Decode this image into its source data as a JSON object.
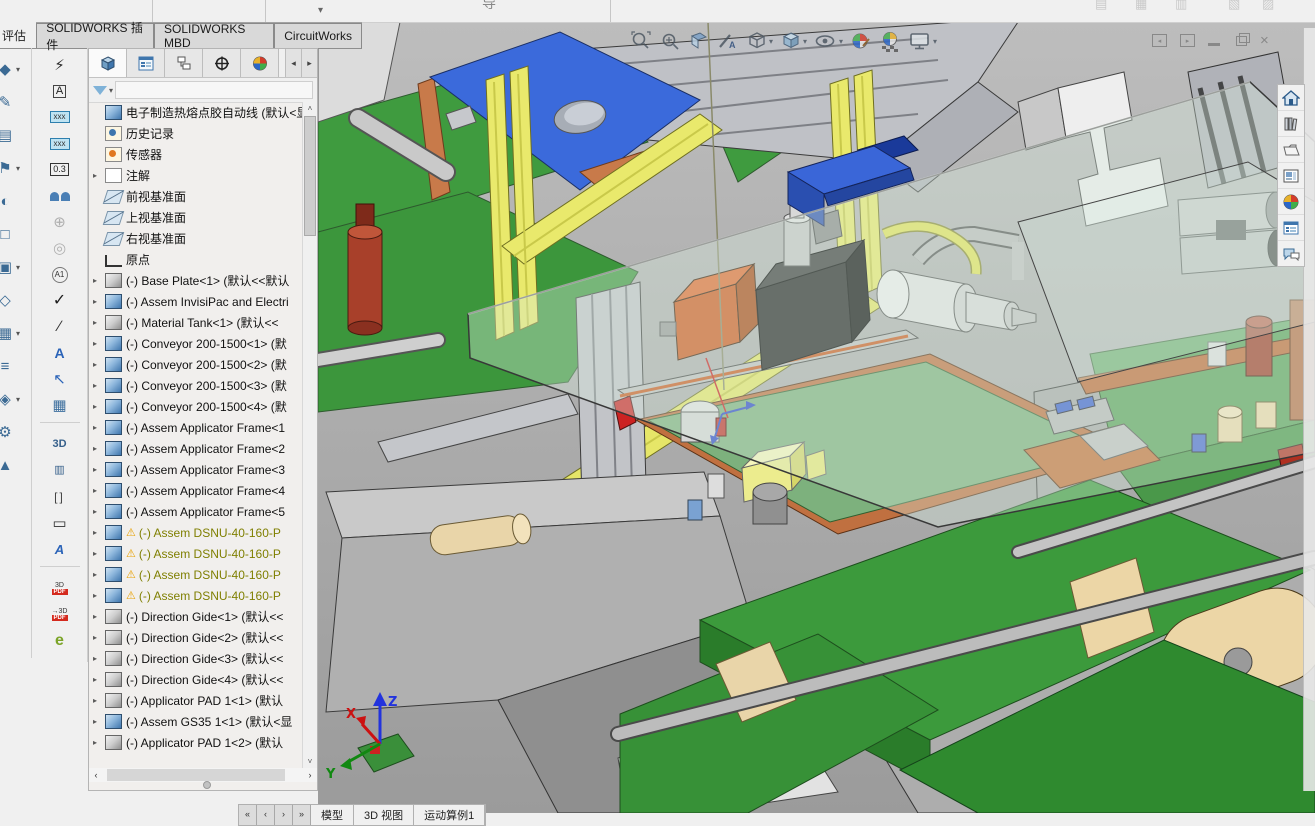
{
  "ribbon": {
    "partial_tab": "评估",
    "tabs": [
      "SOLIDWORKS 插件",
      "SOLIDWORKS MBD",
      "CircuitWorks"
    ],
    "top_strip": {
      "dropdown_glyph": "▾",
      "fragment": "导",
      "ghost_glyphs": [
        "▤",
        "▦",
        "▥",
        "▧",
        "▨"
      ]
    }
  },
  "left_toolbar_primary": [
    {
      "g": "◆",
      "arr": true
    },
    {
      "g": "✎",
      "arr": false
    },
    {
      "g": "▤",
      "arr": false
    },
    {
      "g": "⚑",
      "arr": true
    },
    {
      "g": "◐",
      "arr": false
    },
    {
      "g": "□",
      "arr": false
    },
    {
      "g": "▣",
      "arr": true
    },
    {
      "g": "◇",
      "arr": false
    },
    {
      "g": "▦",
      "arr": true
    },
    {
      "g": "≡",
      "arr": false
    },
    {
      "g": "◈",
      "arr": true
    },
    {
      "g": "⚙",
      "arr": false
    },
    {
      "g": "▲",
      "arr": false
    }
  ],
  "left_toolbar_secondary": [
    {
      "name": "invisipac-power",
      "g": "⚡",
      "g2": "",
      "cls": ""
    },
    {
      "name": "smart-dimension",
      "g": "A",
      "g2": "",
      "cls": "dim"
    },
    {
      "name": "auto-balloon",
      "g": "xxx",
      "g2": "",
      "cls": "bal"
    },
    {
      "name": "balloon",
      "g": "xxx",
      "g2": "",
      "cls": "bal2"
    },
    {
      "name": "geometric-tolerance",
      "g": "0.3",
      "g2": "",
      "cls": "tol"
    },
    {
      "name": "mates",
      "g": "",
      "g2": "",
      "cls": "people"
    },
    {
      "name": "dimxpert-location",
      "g": "⊕",
      "g2": "",
      "cls": "dis"
    },
    {
      "name": "hide-show",
      "g": "◎",
      "g2": "",
      "cls": "dis"
    },
    {
      "name": "magnified-view",
      "g": "A1",
      "g2": "",
      "cls": "maga1"
    },
    {
      "name": "spell-check",
      "g": "✓",
      "g2": "",
      "cls": "chk"
    },
    {
      "name": "measure",
      "g": "∕",
      "g2": "",
      "cls": "meas"
    },
    {
      "name": "note",
      "g": "A",
      "g2": "",
      "cls": "note"
    },
    {
      "name": "leader",
      "g": "↖",
      "g2": "",
      "cls": "arr"
    },
    {
      "name": "general-table",
      "g": "▦",
      "g2": "",
      "cls": "tbl sepafter"
    },
    {
      "name": "3d-view-capture",
      "g": "3D",
      "g2": "",
      "cls": "cam"
    },
    {
      "name": "model-break-view",
      "g": "▥",
      "g2": "",
      "cls": "fold"
    },
    {
      "name": "break-view",
      "g": "[]",
      "g2": "",
      "cls": "brk"
    },
    {
      "name": "annotation-view",
      "g": "▭",
      "g2": "",
      "cls": "pn"
    },
    {
      "name": "weld-symbol",
      "g": "A",
      "g2": "",
      "cls": "scw sepafter"
    },
    {
      "name": "edit-3d-pdf",
      "g": "3D",
      "g2": "PDF",
      "cls": "pdf"
    },
    {
      "name": "publish-3d-pdf",
      "g": "→3D",
      "g2": "PDF",
      "cls": "pdf2"
    },
    {
      "name": "publish-edrawings",
      "g": "e",
      "g2": "",
      "cls": "ed"
    }
  ],
  "feature_manager": {
    "tabs": [
      "features-tree",
      "property-manager",
      "configuration-manager",
      "dimxpert-manager",
      "display-manager"
    ],
    "tab_scroll_left": "◂",
    "tab_scroll_right": "▸",
    "expander_glyph": "▸",
    "warn_glyph": "⚠",
    "scroll_up_glyph": "˄",
    "scroll_down_glyph": "˅",
    "hscroll_left": "‹",
    "hscroll_right": "›",
    "root_label": "电子制造热熔点胶自动线 (默认<显示",
    "tree": [
      {
        "icon": "history",
        "label": "历史记录"
      },
      {
        "icon": "sensor",
        "label": "传感器"
      },
      {
        "icon": "ann",
        "label": "注解",
        "expand": true
      },
      {
        "icon": "plane",
        "label": "前视基准面"
      },
      {
        "icon": "plane",
        "label": "上视基准面"
      },
      {
        "icon": "plane",
        "label": "右视基准面"
      },
      {
        "icon": "origin",
        "label": "原点"
      },
      {
        "icon": "part",
        "expand": true,
        "label": "(-) Base Plate<1> (默认<<默认"
      },
      {
        "icon": "asm",
        "expand": true,
        "label": "(-) Assem InvisiPac and Electri"
      },
      {
        "icon": "part",
        "expand": true,
        "label": "(-) Material Tank<1> (默认<<"
      },
      {
        "icon": "asm",
        "expand": true,
        "label": "(-) Conveyor 200-1500<1> (默"
      },
      {
        "icon": "asm",
        "expand": true,
        "label": "(-) Conveyor 200-1500<2> (默"
      },
      {
        "icon": "asm",
        "expand": true,
        "label": "(-) Conveyor 200-1500<3> (默"
      },
      {
        "icon": "asm",
        "expand": true,
        "label": "(-) Conveyor 200-1500<4> (默"
      },
      {
        "icon": "asm",
        "expand": true,
        "label": "(-) Assem Applicator Frame<1"
      },
      {
        "icon": "asm",
        "expand": true,
        "label": "(-) Assem Applicator Frame<2"
      },
      {
        "icon": "asm",
        "expand": true,
        "label": "(-) Assem Applicator Frame<3"
      },
      {
        "icon": "asm",
        "expand": true,
        "label": "(-) Assem Applicator Frame<4"
      },
      {
        "icon": "asm",
        "expand": true,
        "label": "(-) Assem Applicator Frame<5"
      },
      {
        "icon": "asm",
        "expand": true,
        "warn": true,
        "label": "(-) Assem DSNU-40-160-P"
      },
      {
        "icon": "asm",
        "expand": true,
        "warn": true,
        "label": "(-) Assem DSNU-40-160-P"
      },
      {
        "icon": "asm",
        "expand": true,
        "warn": true,
        "label": "(-) Assem DSNU-40-160-P"
      },
      {
        "icon": "asm",
        "expand": true,
        "warn": true,
        "label": "(-) Assem DSNU-40-160-P"
      },
      {
        "icon": "part",
        "expand": true,
        "label": "(-) Direction Gide<1> (默认<<"
      },
      {
        "icon": "part",
        "expand": true,
        "label": "(-) Direction Gide<2> (默认<<"
      },
      {
        "icon": "part",
        "expand": true,
        "label": "(-) Direction Gide<3> (默认<<"
      },
      {
        "icon": "part",
        "expand": true,
        "label": "(-) Direction Gide<4> (默认<<"
      },
      {
        "icon": "part",
        "expand": true,
        "label": "(-) Applicator PAD 1<1> (默认"
      },
      {
        "icon": "asm",
        "expand": true,
        "label": "(-) Assem GS35 1<1> (默认<显"
      },
      {
        "icon": "part",
        "expand": true,
        "label": "(-) Applicator PAD 1<2> (默认"
      }
    ]
  },
  "viewport": {
    "heads_up_icons": [
      "zoom-fit",
      "zoom-area",
      "section-view",
      "measure",
      "view-orientation",
      "display-style",
      "hide-show-items",
      "edit-appearance",
      "apply-scene",
      "view-settings"
    ],
    "window_controls": [
      "previous-window",
      "next-window",
      "minimize",
      "restore",
      "close"
    ],
    "triad": {
      "x": "X",
      "y": "Y",
      "z": "Z"
    }
  },
  "task_pane_icons": [
    "home",
    "design-library",
    "file-explorer",
    "view-palette",
    "appearances",
    "custom-properties",
    "forum"
  ],
  "bottom_bar": {
    "nav_glyphs": [
      "«",
      "‹",
      "›",
      "»"
    ],
    "tabs": [
      "模型",
      "3D 视图",
      "运动算例1"
    ]
  },
  "colors": {
    "accent_blue": "#3b6adb",
    "machine_green": "#3c9a3c",
    "gantry_yellow": "#e9e96c",
    "warn_text": "#7f7f00",
    "warn_icon": "#e8a000",
    "orange_rim": "#c87a4a"
  }
}
